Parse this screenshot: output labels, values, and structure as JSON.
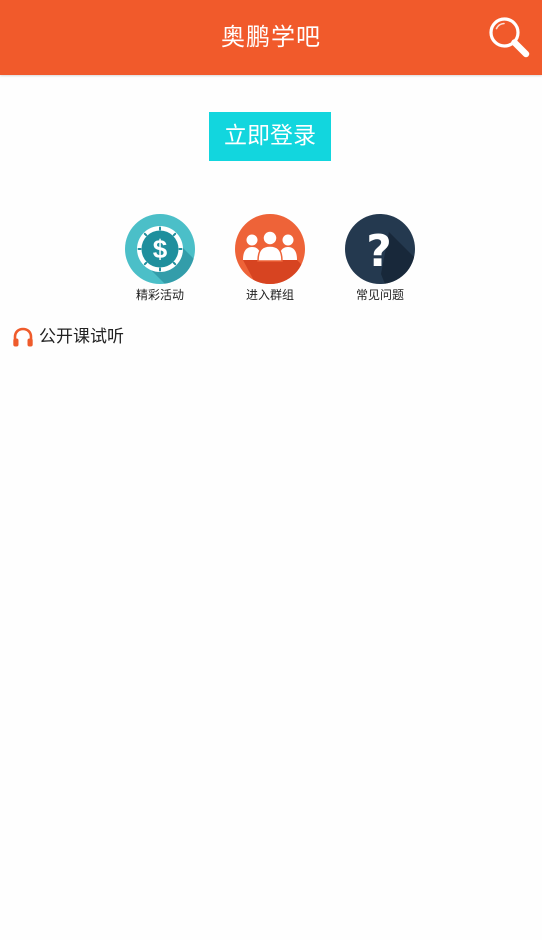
{
  "header": {
    "title": "奥鹏学吧",
    "search_icon": "search-icon",
    "background_color": "#f15a2b"
  },
  "login": {
    "label": "立即登录",
    "color": "#12d6de"
  },
  "shortcuts": [
    {
      "label": "精彩活动",
      "icon": "dollar-coin-icon",
      "color": "#4bbfc8"
    },
    {
      "label": "进入群组",
      "icon": "group-users-icon",
      "color": "#ee6338"
    },
    {
      "label": "常见问题",
      "icon": "question-mark-icon",
      "color": "#24394f"
    }
  ],
  "section": {
    "title": "公开课试听",
    "icon": "headphones-icon",
    "icon_color": "#ef5b2b"
  }
}
